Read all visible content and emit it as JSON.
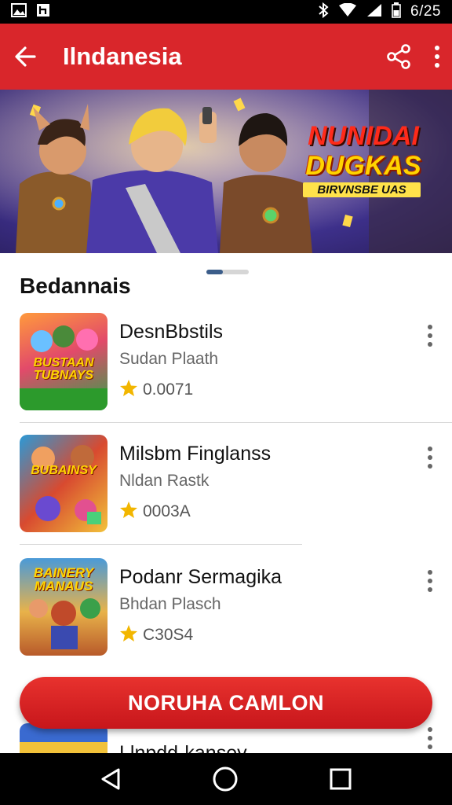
{
  "status_bar": {
    "time": "6/25"
  },
  "app_bar": {
    "title": "Ilndanesia",
    "back_icon": "arrow-back-icon",
    "share_icon": "share-icon",
    "more_icon": "more-vert-icon"
  },
  "banner": {
    "title_line1": "NUNIDAI",
    "title_line2": "DUGKAS",
    "subtitle": "BIRVNSBE UAS"
  },
  "section": {
    "title": "Bedannais"
  },
  "items": [
    {
      "title": "DesnBbstils",
      "subtitle": "Sudan Plaath",
      "rating": "0.0071",
      "thumb_label": "BUSTAAN TUBNAYS"
    },
    {
      "title": "Milsbm Finglanss",
      "subtitle": "Nldan Rastk",
      "rating": "0003A",
      "thumb_label": "BUBAINSY"
    },
    {
      "title": "Podanr Sermagika",
      "subtitle": "Bhdan Plasch",
      "rating": "C30S4",
      "thumb_label": "BAINERY MANAUS"
    }
  ],
  "cta": {
    "label": "NORUHA CAMLON"
  },
  "peek_item": {
    "title": "Llnpdd-kansey"
  },
  "colors": {
    "primary": "#d9262b",
    "star": "#f2b600"
  }
}
